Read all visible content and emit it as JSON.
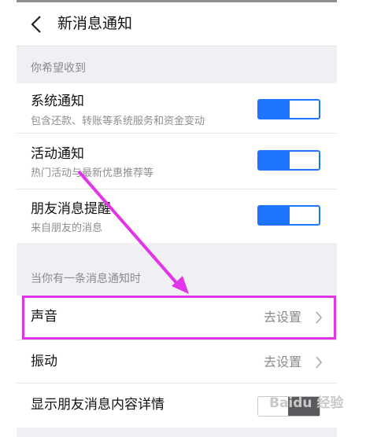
{
  "header": {
    "title": "新消息通知",
    "back_icon": "back-arrow-icon"
  },
  "section1": {
    "label": "你希望收到",
    "items": [
      {
        "title": "系统通知",
        "subtitle": "包含还款、转账等系统服务和资金变动",
        "enabled": true
      },
      {
        "title": "活动通知",
        "subtitle": "热门活动与最新优惠推荐等",
        "enabled": true
      },
      {
        "title": "朋友消息提醒",
        "subtitle": "来自朋友的消息",
        "enabled": true
      }
    ]
  },
  "section2": {
    "label": "当你有一条消息通知时",
    "items": [
      {
        "title": "声音",
        "value": "去设置"
      },
      {
        "title": "振动",
        "value": "去设置"
      },
      {
        "title": "显示朋友消息内容详情",
        "enabled": false
      }
    ]
  },
  "annotation": {
    "color": "#e234e8"
  },
  "watermark": {
    "text": "Baidu 经验"
  },
  "colors": {
    "accent": "#1e74fd",
    "background": "#efeff4"
  }
}
